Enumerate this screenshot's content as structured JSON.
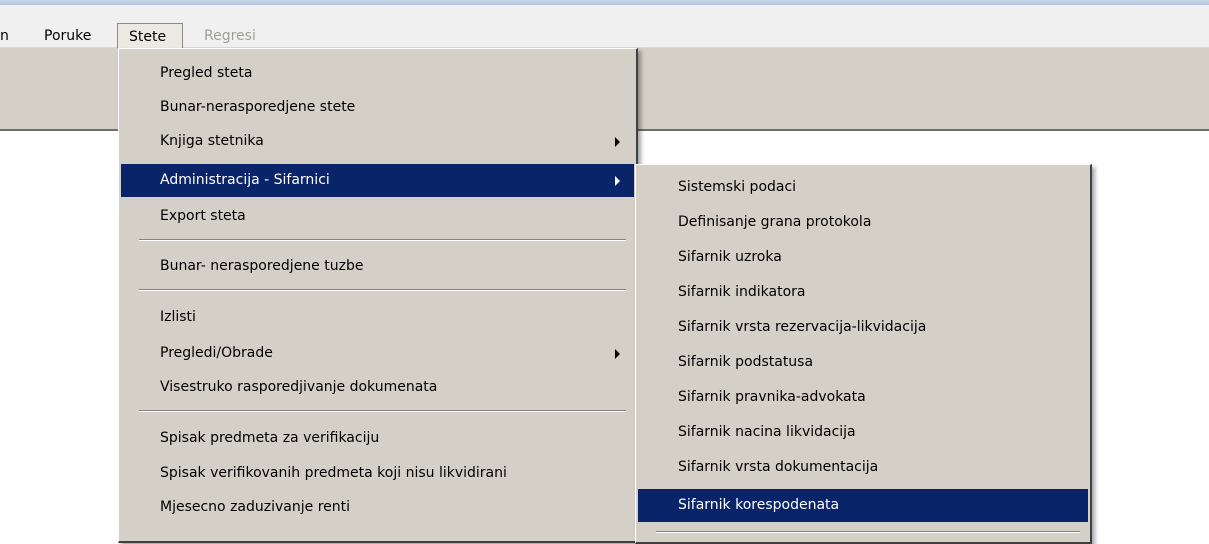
{
  "menubar": {
    "items": [
      {
        "label": "n"
      },
      {
        "label": "Poruke"
      },
      {
        "label": "Stete"
      },
      {
        "label": "Regresi"
      }
    ]
  },
  "stete_menu": {
    "items": [
      {
        "label": "Pregled steta"
      },
      {
        "label": "Bunar-nerasporedjene stete"
      },
      {
        "label": "Knjiga stetnika"
      },
      {
        "label": "Administracija - Sifarnici"
      },
      {
        "label": "Export steta"
      },
      {
        "label": "Bunar- nerasporedjene tuzbe"
      },
      {
        "label": "Izlisti"
      },
      {
        "label": "Pregledi/Obrade"
      },
      {
        "label": "Visestruko rasporedjivanje dokumenata"
      },
      {
        "label": "Spisak predmeta za verifikaciju"
      },
      {
        "label": "Spisak verifikovanih predmeta koji nisu likvidirani"
      },
      {
        "label": "Mjesecno zaduzivanje renti"
      }
    ]
  },
  "sifarnici_menu": {
    "items": [
      {
        "label": "Sistemski podaci"
      },
      {
        "label": "Definisanje grana protokola"
      },
      {
        "label": "Sifarnik uzroka"
      },
      {
        "label": "Sifarnik indikatora"
      },
      {
        "label": "Sifarnik vrsta rezervacija-likvidacija"
      },
      {
        "label": "Sifarnik podstatusa"
      },
      {
        "label": "Sifarnik pravnika-advokata"
      },
      {
        "label": "Sifarnik nacina likvidacija"
      },
      {
        "label": "Sifarnik vrsta dokumentacija"
      },
      {
        "label": "Sifarnik korespodenata"
      }
    ]
  },
  "colors": {
    "highlight": "#0a246a",
    "menu_background": "#d4d0c8",
    "disabled_text": "#a09e98"
  }
}
